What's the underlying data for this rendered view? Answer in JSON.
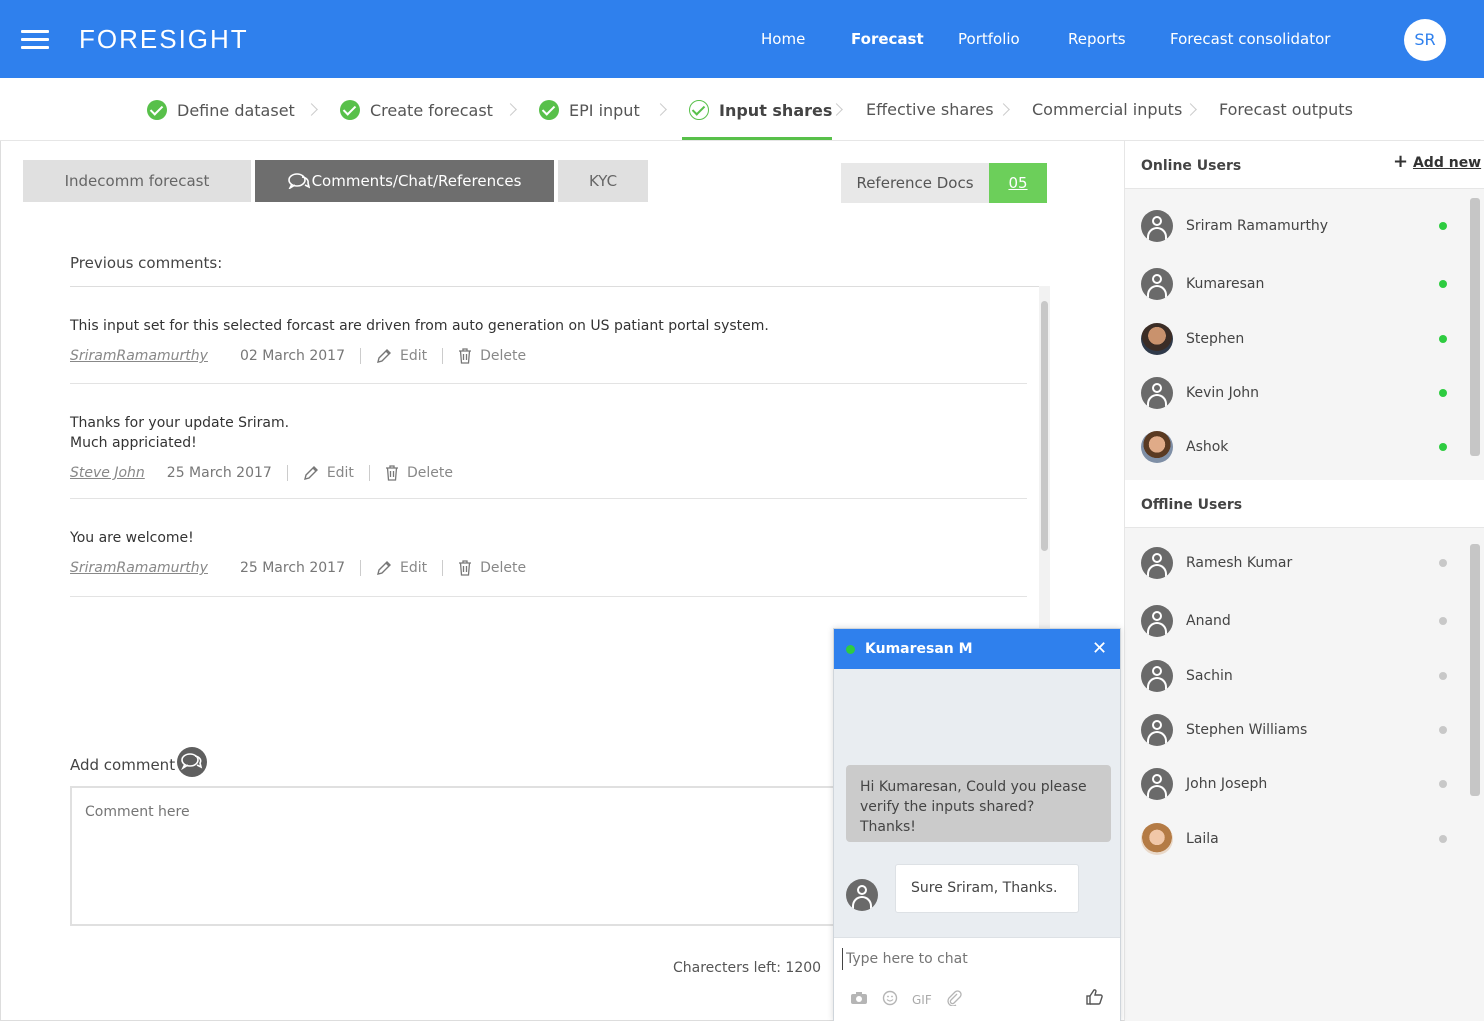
{
  "header": {
    "brand": "FORESIGHT",
    "nav": [
      "Home",
      "Forecast",
      "Portfolio",
      "Reports",
      "Forecast consolidator"
    ],
    "active_nav": "Forecast",
    "user_initials": "SR"
  },
  "stepper": {
    "steps": [
      "Define dataset",
      "Create forecast",
      "EPI input",
      "Input shares",
      "Effective shares",
      "Commercial inputs",
      "Forecast outputs"
    ],
    "active": "Input shares"
  },
  "tabs": {
    "indecomm": "Indecomm forecast",
    "comments": "Comments/Chat/References",
    "kyc": "KYC",
    "reference_docs": "Reference Docs",
    "reference_count": "05"
  },
  "comments": {
    "label": "Previous comments:",
    "edit_label": "Edit",
    "delete_label": "Delete",
    "items": [
      {
        "text": [
          "This input set for this selected forcast are driven from auto generation on US patiant portal system."
        ],
        "author": "SriramRamamurthy",
        "date": "02 March 2017"
      },
      {
        "text": [
          "Thanks for your update Sriram.",
          "Much appriciated!"
        ],
        "author": "Steve John",
        "date": "25 March 2017"
      },
      {
        "text": [
          "You are welcome!"
        ],
        "author": "SriramRamamurthy",
        "date": "25 March 2017"
      }
    ]
  },
  "add_comment": {
    "label": "Add comment",
    "placeholder": "Comment here",
    "chars_left": "Charecters left: 1200"
  },
  "sidebar": {
    "online_title": "Online Users",
    "add_new": "Add new",
    "offline_title": "Offline Users",
    "online": [
      "Sriram Ramamurthy",
      "Kumaresan",
      "Stephen",
      "Kevin John",
      "Ashok"
    ],
    "offline": [
      "Ramesh Kumar",
      "Anand",
      "Sachin",
      "Stephen Williams",
      "John Joseph",
      "Laila"
    ]
  },
  "chat": {
    "name": "Kumaresan M",
    "incoming": [
      "Hi Kumaresan, Could you please",
      "verify the inputs shared?",
      "Thanks!"
    ],
    "outgoing": "Sure Sriram, Thanks.",
    "placeholder": "Type here to chat",
    "gif": "GIF"
  },
  "colors": {
    "primary": "#2f80ed",
    "success": "#58c04a",
    "online": "#2ecc40"
  }
}
